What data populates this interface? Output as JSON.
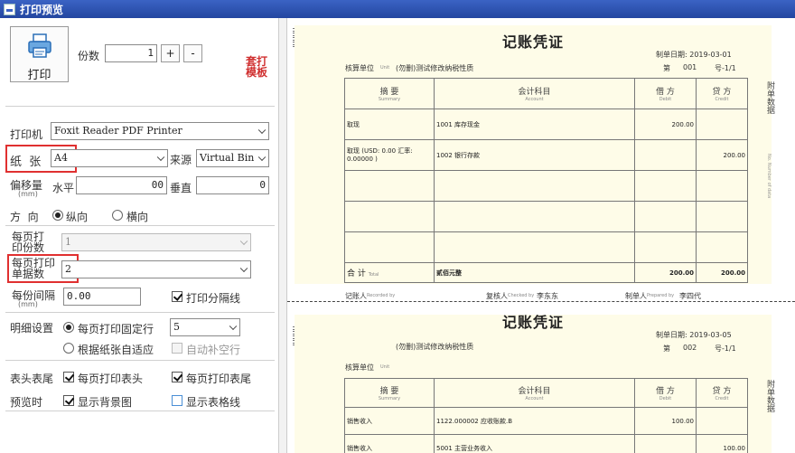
{
  "window": {
    "title": "打印预览"
  },
  "toolbar": {
    "print_label": "打印",
    "copies_label": "份数",
    "copies_value": "1",
    "plus_label": "+",
    "minus_label": "-",
    "template_line1": "套打",
    "template_line2": "模板"
  },
  "settings": {
    "printer_label": "打印机",
    "printer_value": "Foxit Reader PDF Printer",
    "paper_label": "纸  张",
    "paper_value": "A4",
    "source_label": "来源",
    "source_value": "Virtual Bin",
    "offset_label": "偏移量",
    "offset_unit": "(mm)",
    "horizontal_label": "水平",
    "horizontal_value": "00",
    "vertical_label": "垂直",
    "vertical_value": "0",
    "orientation_label": "方  向",
    "portrait_label": "纵向",
    "landscape_label": "横向",
    "copies_per_page_label_1": "每页打",
    "copies_per_page_label_2": "印份数",
    "copies_per_page_value": "1",
    "docs_per_page_label_1": "每页打印",
    "docs_per_page_label_2": "单据数",
    "docs_per_page_value": "2",
    "spacing_label_1": "每份间隔",
    "spacing_unit": "(mm)",
    "spacing_value": "0.00",
    "print_separator_label": "打印分隔线",
    "detail_label": "明细设置",
    "fixed_rows_label": "每页打印固定行",
    "fixed_rows_value": "5",
    "auto_fit_label": "根据纸张自适应",
    "auto_fill_label": "自动补空行",
    "header_footer_label": "表头表尾",
    "print_header_label": "每页打印表头",
    "print_footer_label": "每页打印表尾",
    "preview_label": "预览时",
    "show_bg_label": "显示背景图",
    "show_grid_label": "显示表格线"
  },
  "preview": {
    "v1": {
      "title": "记账凭证",
      "date": "制单日期: 2019-03-01",
      "no_label": "第",
      "no": "001",
      "page": "号-1/1",
      "unit_label": "核算单位",
      "unit_en": "Unit",
      "unit_value": "(勿删)测试修改纳税性质",
      "col_summary": "摘 要",
      "col_summary_en": "Summary",
      "col_account": "会计科目",
      "col_account_en": "Account",
      "col_debit": "借 方",
      "col_debit_en": "Debit",
      "col_credit": "贷 方",
      "col_credit_en": "Credit",
      "rows": [
        {
          "summary": "取现",
          "account": "1001 库存现金",
          "debit": "200.00",
          "credit": ""
        },
        {
          "summary": "取现 (USD: 0.00 汇率: 0.00000 )",
          "account": "1002 银行存款",
          "debit": "",
          "credit": "200.00"
        }
      ],
      "total_label": "合 计",
      "total_en": "Total",
      "total_words": "贰佰元整",
      "total_debit": "200.00",
      "total_credit": "200.00",
      "bookkeeper_label": "记账人",
      "bookkeeper_en": "Recorded by",
      "reviewer_label": "复核人",
      "reviewer_en": "Checked by",
      "reviewer_value": "李东东",
      "maker_label": "制单人",
      "maker_en": "Prepared by",
      "maker_value": "李四代",
      "side_attach": "附单数据",
      "side_number": "No. Number of data"
    },
    "v2": {
      "title": "记账凭证",
      "date": "制单日期: 2019-03-05",
      "no_label": "第",
      "no": "002",
      "page": "号-1/1",
      "unit_label": "核算单位",
      "unit_en": "Unit",
      "unit_value": "(勿删)测试修改纳税性质",
      "col_summary": "摘 要",
      "col_summary_en": "Summary",
      "col_account": "会计科目",
      "col_account_en": "Account",
      "col_debit": "借 方",
      "col_debit_en": "Debit",
      "col_credit": "贷 方",
      "col_credit_en": "Credit",
      "rows": [
        {
          "summary": "销售收入",
          "account": "1122.000002 应收账款.B",
          "debit": "100.00",
          "credit": ""
        },
        {
          "summary": "销售收入",
          "account": "5001 主营业务收入",
          "debit": "",
          "credit": "100.00"
        }
      ],
      "side_attach": "附单数据"
    }
  }
}
